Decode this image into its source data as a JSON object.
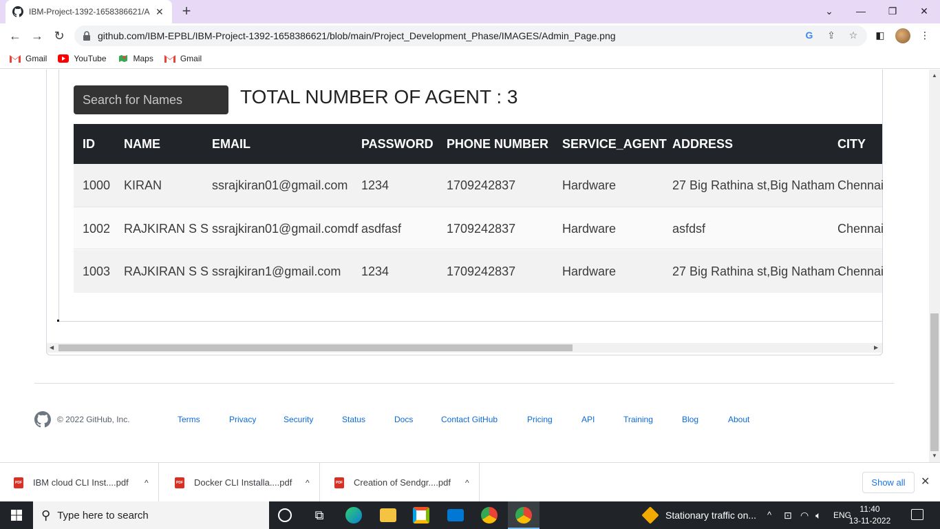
{
  "browser": {
    "tab_title": "IBM-Project-1392-1658386621/A",
    "tab_close": "✕",
    "new_tab": "+",
    "url": "github.com/IBM-EPBL/IBM-Project-1392-1658386621/blob/main/Project_Development_Phase/IMAGES/Admin_Page.png",
    "window_controls": {
      "chevron": "⌄",
      "minimize": "—",
      "restore": "❐",
      "close": "✕"
    },
    "nav": {
      "back": "←",
      "forward": "→",
      "reload": "↻"
    },
    "bookmarks": [
      {
        "label": "Gmail",
        "icon": "gmail-icon"
      },
      {
        "label": "YouTube",
        "icon": "youtube-icon"
      },
      {
        "label": "Maps",
        "icon": "maps-icon"
      },
      {
        "label": "Gmail",
        "icon": "gmail-icon"
      }
    ]
  },
  "admin": {
    "search_placeholder": "Search for Names",
    "total_label": "TOTAL NUMBER OF AGENT : ",
    "total_value": "3",
    "columns": [
      "ID",
      "NAME",
      "EMAIL",
      "PASSWORD",
      "PHONE NUMBER",
      "SERVICE_AGENT",
      "ADDRESS",
      "CITY"
    ],
    "rows": [
      [
        "1000",
        "KIRAN",
        "ssrajkiran01@gmail.com",
        "1234",
        "1709242837",
        "Hardware",
        "27 Big Rathina st,Big Natham",
        "Chennai"
      ],
      [
        "1002",
        "RAJKIRAN S S",
        "ssrajkiran01@gmail.comdf",
        "asdfasf",
        "1709242837",
        "Hardware",
        "asfdsf",
        "Chennai"
      ],
      [
        "1003",
        "RAJKIRAN S S",
        "ssrajkiran1@gmail.com",
        "1234",
        "1709242837",
        "Hardware",
        "27 Big Rathina st,Big Natham",
        "Chennai"
      ]
    ]
  },
  "footer": {
    "copyright": "© 2022 GitHub, Inc.",
    "links": [
      "Terms",
      "Privacy",
      "Security",
      "Status",
      "Docs",
      "Contact GitHub",
      "Pricing",
      "API",
      "Training",
      "Blog",
      "About"
    ]
  },
  "downloads": {
    "items": [
      "IBM cloud CLI Inst....pdf",
      "Docker CLI Installa....pdf",
      "Creation of Sendgr....pdf"
    ],
    "pdf_badge": "PDF",
    "caret": "^",
    "show_all": "Show all",
    "close": "✕"
  },
  "taskbar": {
    "search_placeholder": "Type here to search",
    "weather_text": "Stationary traffic on...",
    "language": "ENG",
    "time": "11:40",
    "date": "13-11-2022"
  },
  "colors": {
    "table_header_bg": "#212529",
    "search_bg": "#333333",
    "link_blue": "#0969da",
    "tabstrip_bg": "#e8d9f7"
  }
}
